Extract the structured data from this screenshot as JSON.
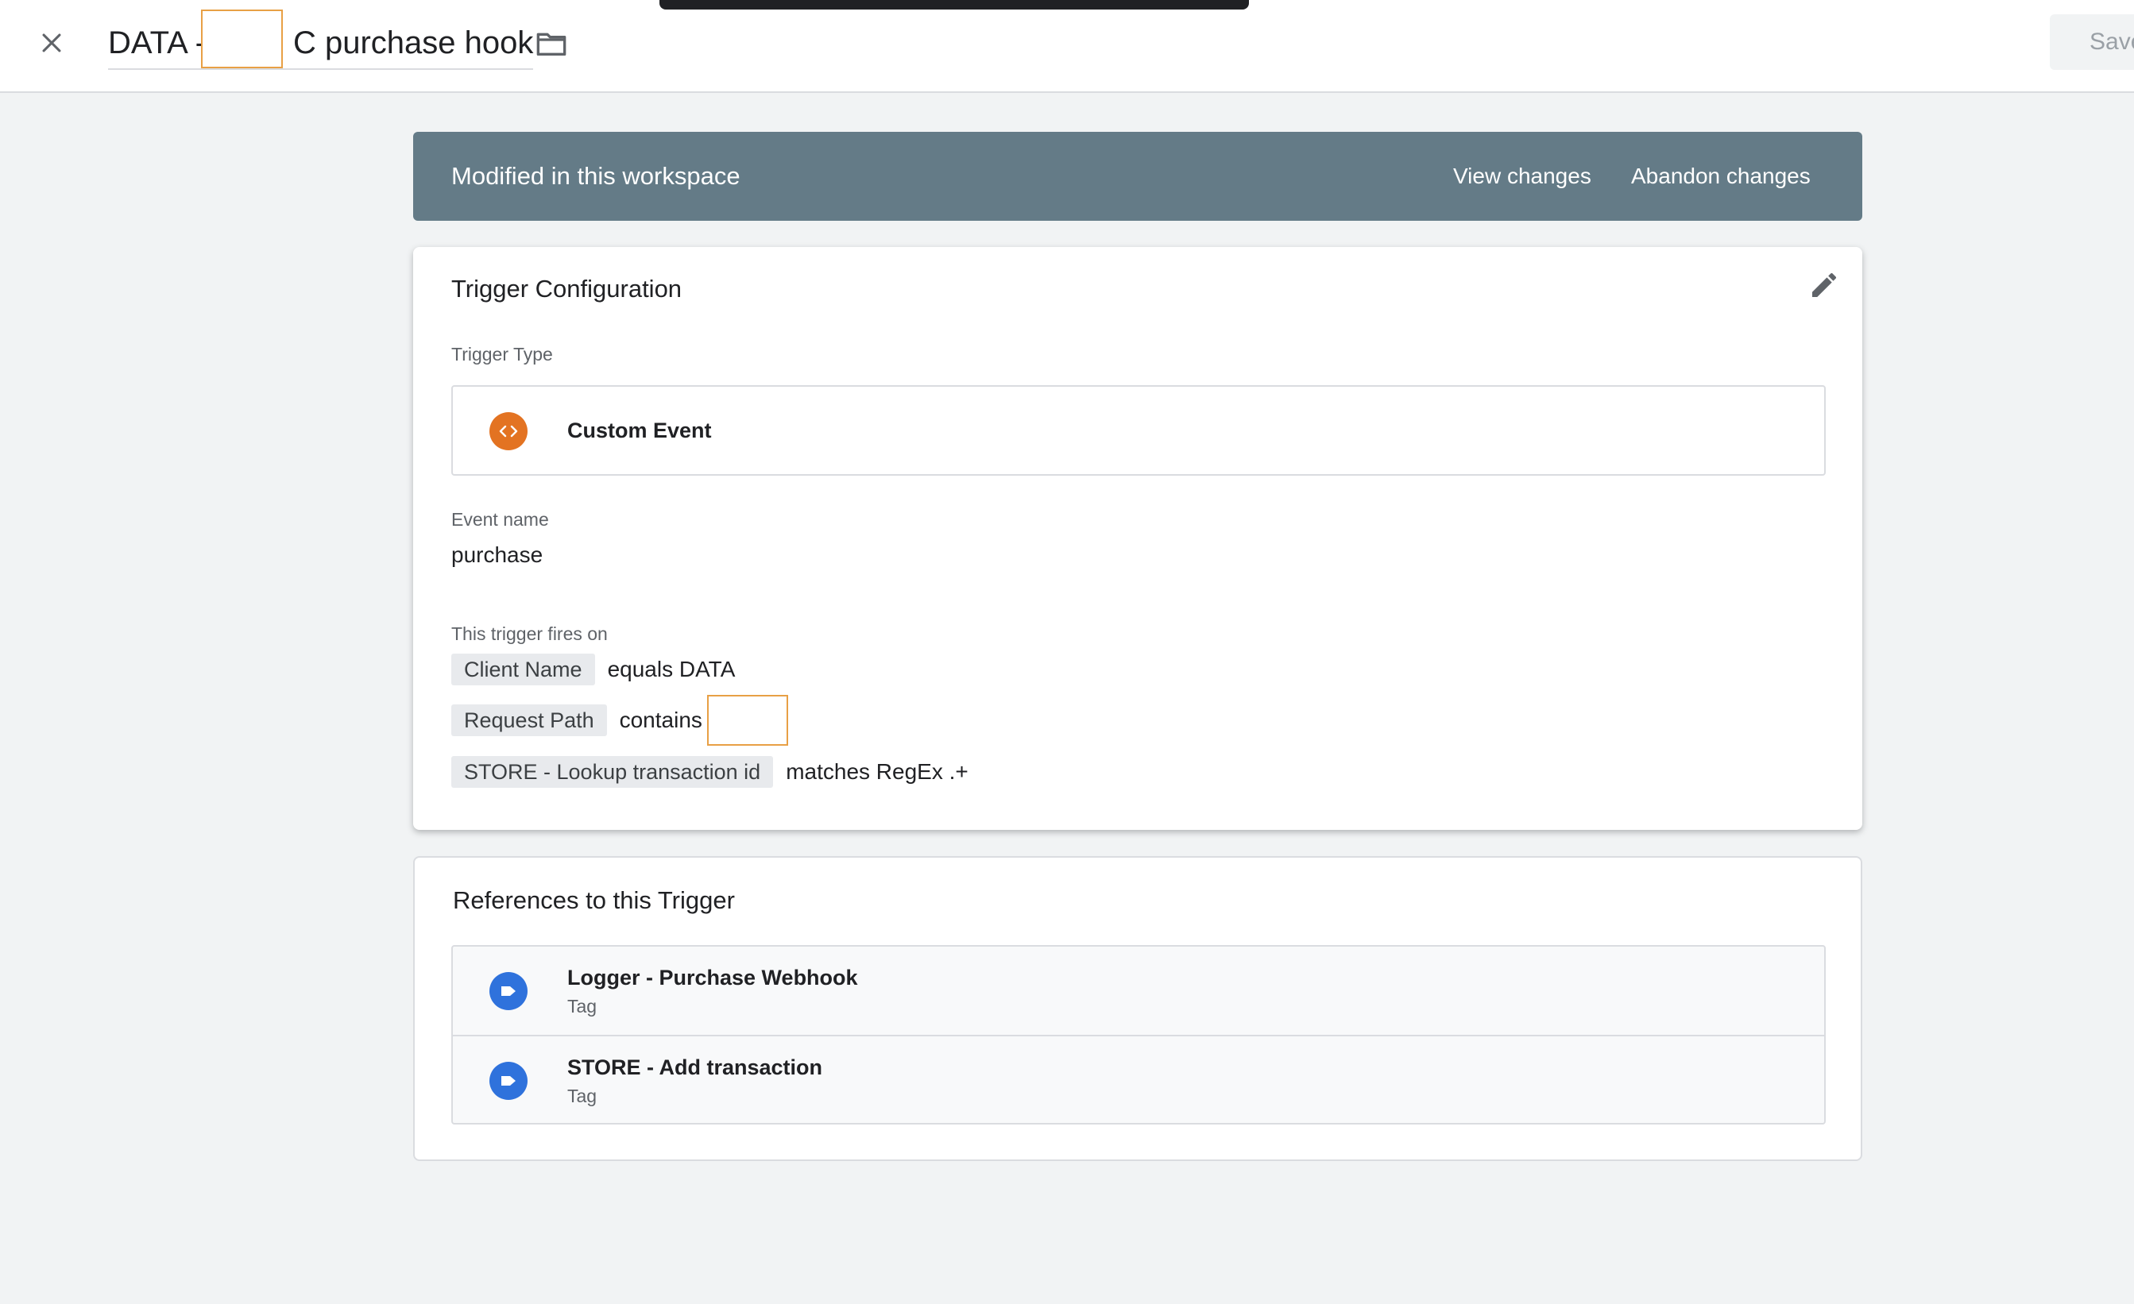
{
  "header": {
    "title_prefix": "DATA -",
    "title_suffix": "C purchase hook",
    "save_label": "Save"
  },
  "banner": {
    "title": "Modified in this workspace",
    "view_changes": "View changes",
    "abandon_changes": "Abandon changes",
    "color": "#647b87"
  },
  "config": {
    "title": "Trigger Configuration",
    "trigger_type_label": "Trigger Type",
    "trigger_type_name": "Custom Event",
    "trigger_type_icon": "code-brackets-icon",
    "event_name_label": "Event name",
    "event_name_value": "purchase",
    "fires_on_label": "This trigger fires on",
    "conditions": [
      {
        "variable": "Client Name",
        "operator": "equals DATA"
      },
      {
        "variable": "Request Path",
        "operator": "contains"
      },
      {
        "variable": "STORE - Lookup transaction id",
        "operator": "matches RegEx .+"
      }
    ]
  },
  "references": {
    "title": "References to this Trigger",
    "items": [
      {
        "name": "Logger - Purchase Webhook",
        "type": "Tag",
        "icon": "tag-icon"
      },
      {
        "name": "STORE - Add transaction",
        "type": "Tag",
        "icon": "tag-icon"
      }
    ]
  }
}
